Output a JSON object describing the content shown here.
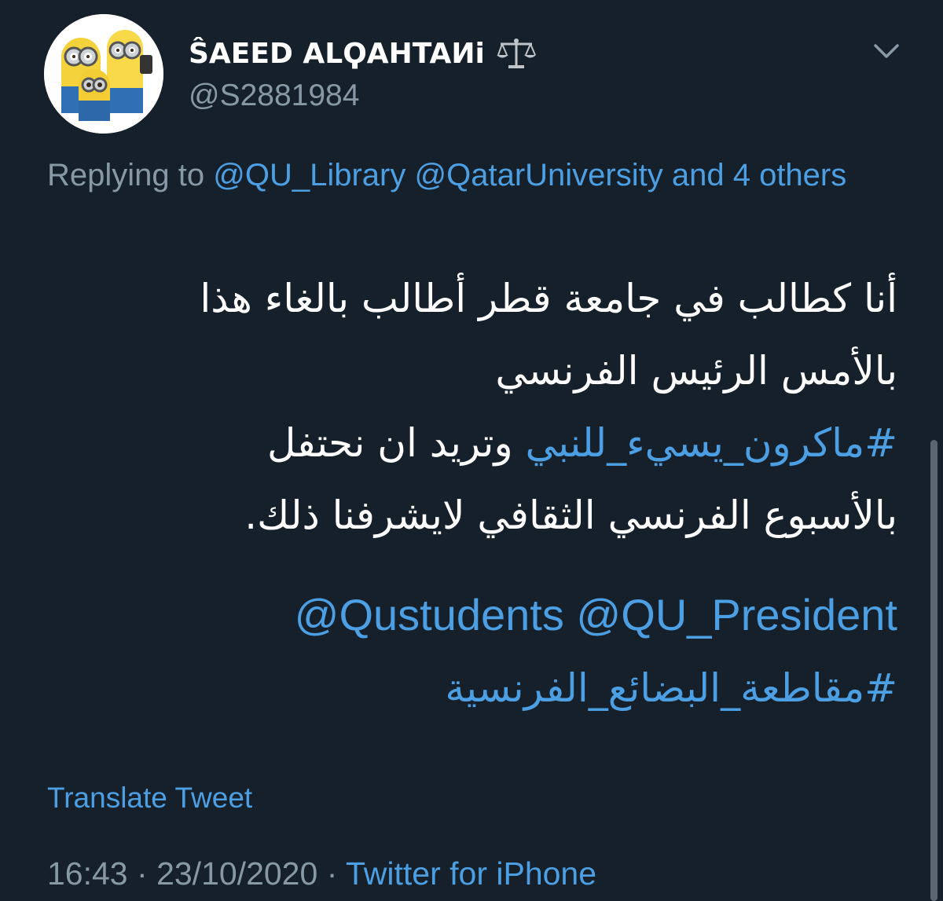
{
  "user": {
    "display_name": "ŜAEED ALϘAHTAИi",
    "handle": "@S2881984",
    "avatar_icon": "minions-avatar",
    "badge_icon": "scales-icon"
  },
  "header": {
    "menu_icon": "chevron-down-icon"
  },
  "reply": {
    "prefix": "Replying to",
    "mention_1": "@QU_Library",
    "mention_2": "@QatarUniversity",
    "suffix": "and 4 others"
  },
  "tweet": {
    "line_1": "أنا كطالب في جامعة قطر أطالب بالغاء هذا",
    "line_2": "بالأمس الرئيس الفرنسي",
    "hashtag_1": "#ماكرون_يسيء_للنبي",
    "line_3_text": " وتريد ان نحتفل",
    "line_4": "بالأسبوع الفرنسي الثقافي لايشرفنا ذلك.",
    "mention_3": "@Qustudents",
    "mention_4": "@QU_President",
    "hashtag_2": "#مقاطعة_البضائع_الفرنسية"
  },
  "translate_label": "Translate Tweet",
  "meta": {
    "time": "16:43",
    "separator": "·",
    "date": "23/10/2020",
    "source": "Twitter for iPhone"
  },
  "colors": {
    "background": "#15202b",
    "secondary_text": "#8899a6",
    "link": "#4d9fe3",
    "primary_text": "#ffffff"
  }
}
